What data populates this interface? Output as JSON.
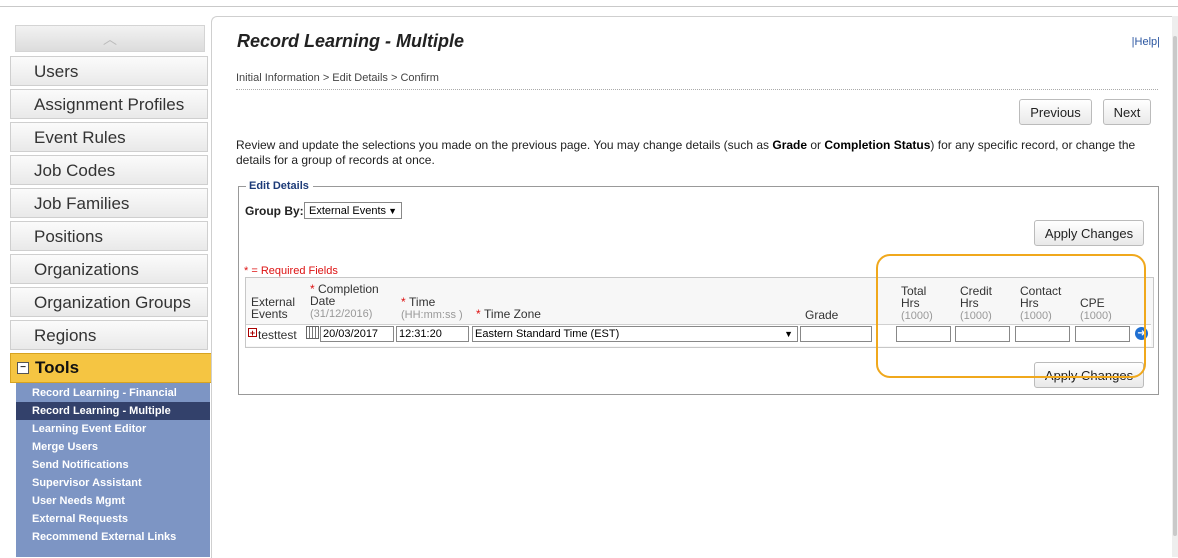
{
  "sidebar": {
    "items": [
      {
        "label": "Users"
      },
      {
        "label": "Assignment Profiles"
      },
      {
        "label": "Event Rules"
      },
      {
        "label": "Job Codes"
      },
      {
        "label": "Job Families"
      },
      {
        "label": "Positions"
      },
      {
        "label": "Organizations"
      },
      {
        "label": "Organization Groups"
      },
      {
        "label": "Regions"
      }
    ],
    "tools_label": "Tools",
    "tools_items": [
      {
        "label": "Record Learning - Financial"
      },
      {
        "label": "Record Learning - Multiple"
      },
      {
        "label": "Learning Event Editor"
      },
      {
        "label": "Merge Users"
      },
      {
        "label": "Send Notifications"
      },
      {
        "label": "Supervisor Assistant"
      },
      {
        "label": "User Needs Mgmt"
      },
      {
        "label": "External Requests"
      },
      {
        "label": "Recommend External Links"
      }
    ]
  },
  "main": {
    "title": "Record Learning - Multiple",
    "help": "|Help|",
    "breadcrumb": "Initial Information > Edit Details > Confirm",
    "previous_label": "Previous",
    "next_label": "Next",
    "desc_part1": "Review and update the selections you made on the previous page. You may change details (such as ",
    "desc_grade": "Grade",
    "desc_or": " or ",
    "desc_status": "Completion Status",
    "desc_part2": ") for any specific record, or change the details for a group of records at once.",
    "legend": "Edit Details",
    "group_by_label": "Group By:",
    "group_by_value": "External Events",
    "apply_label": "Apply Changes",
    "required_note": "* = Required Fields",
    "columns": {
      "external_events": "External Events",
      "completion_date": "Completion Date",
      "completion_date_hint": "(31/12/2016)",
      "time": "Time",
      "time_hint": "(HH:mm:ss )",
      "time_zone": "Time Zone",
      "grade": "Grade",
      "total_hrs": "Total Hrs",
      "credit_hrs": "Credit Hrs",
      "contact_hrs": "Contact Hrs",
      "cpe": "CPE",
      "hrs_hint": "(1000)"
    },
    "row": {
      "event": "testtest",
      "date": "20/03/2017",
      "time": "12:31:20",
      "time_zone": "Eastern Standard Time (EST)"
    }
  },
  "colors": {
    "tools_accent": "#f5c542",
    "subnav_bg": "#7d95c4",
    "subnav_active": "#33416b",
    "highlight": "#f0a81c"
  }
}
